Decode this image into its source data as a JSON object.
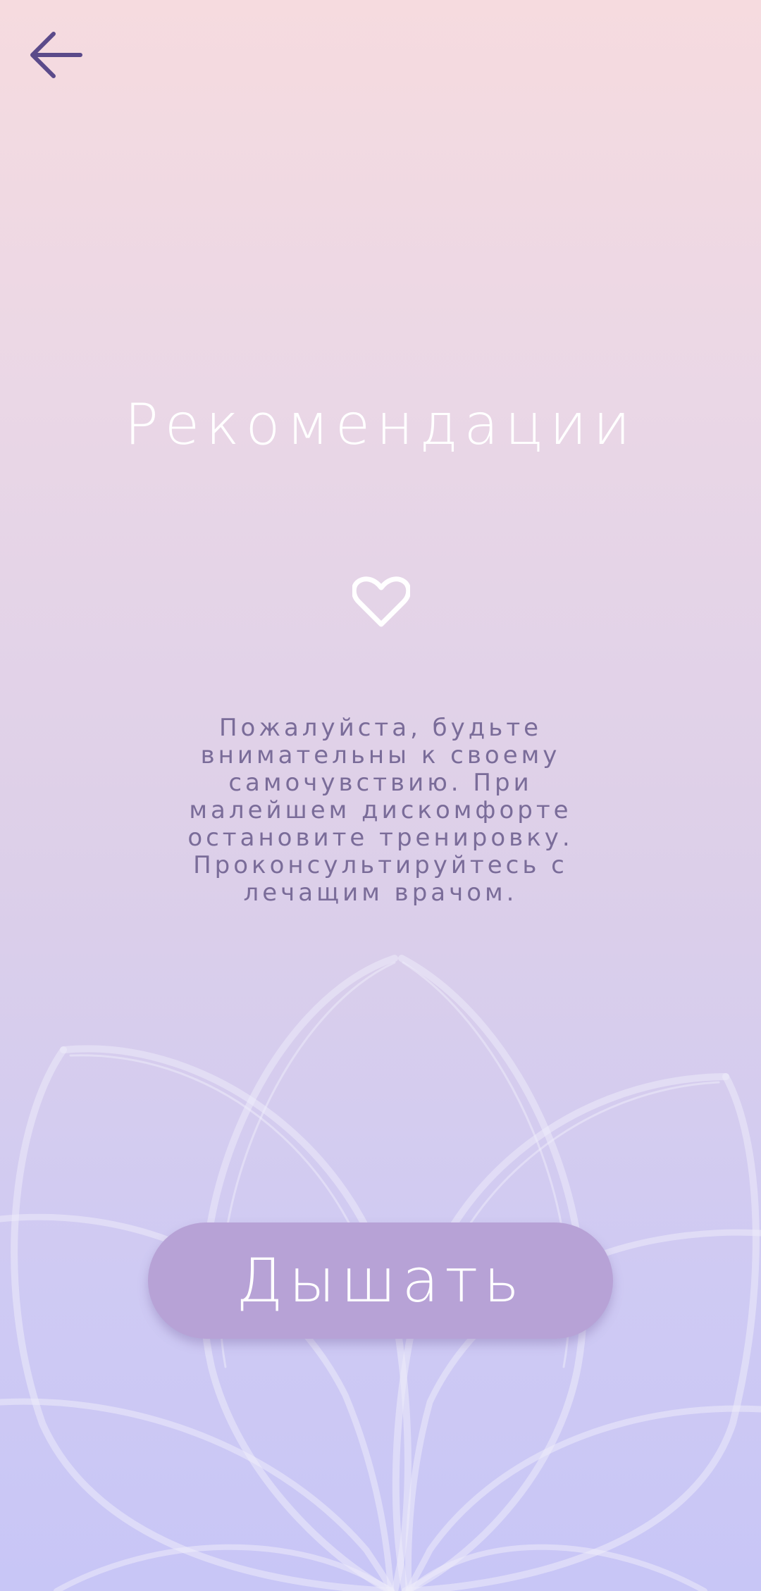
{
  "header": {
    "back_icon": "arrow-left-icon"
  },
  "main": {
    "title": "Рекомендации",
    "heart_icon": "heart-outline-icon",
    "message": "Пожалуйста, будьте\nвнимательны к своему\nсамочувствию. При\nмалейшем дискомфорте\nостановите тренировку.\nПроконсультируйтесь с\nлечащим врачом."
  },
  "action": {
    "button_label": "Дышать"
  },
  "colors": {
    "accent": "#5b4a8a",
    "button": "#b7a2d6",
    "text": "#7a6c99"
  }
}
